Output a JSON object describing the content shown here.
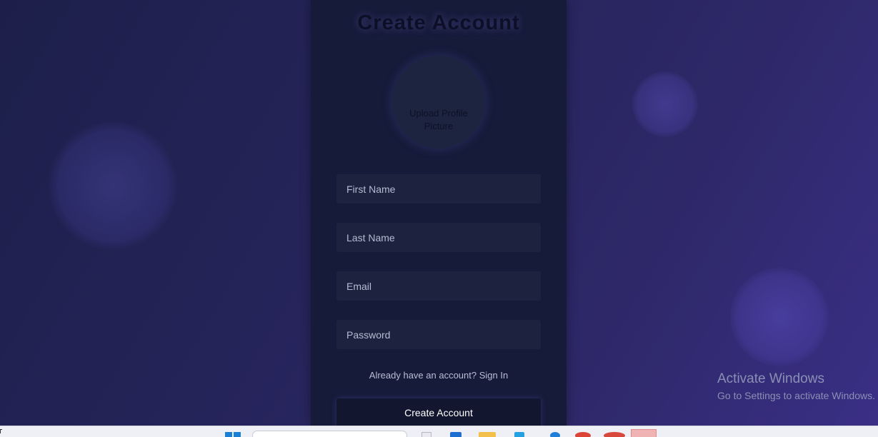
{
  "signup": {
    "title": "Create Account",
    "upload_line1": "Upload Profile",
    "upload_line2": "Picture",
    "first_name_placeholder": "First Name",
    "last_name_placeholder": "Last Name",
    "email_placeholder": "Email",
    "password_placeholder": "Password",
    "signin_prompt": "Already have an account?",
    "signin_link": "Sign In",
    "submit_label": "Create Account"
  },
  "watermark": {
    "title": "Activate Windows",
    "subtitle": "Go to Settings to activate Windows."
  },
  "taskbar": {
    "icons": [
      "windows-start-icon",
      "search-box",
      "file-explorer-icon",
      "outlook-icon",
      "folder-icon",
      "store-icon",
      "edge-icon",
      "chrome-icon",
      "chrome-profile-icon",
      "active-app-icon"
    ]
  },
  "colors": {
    "background_start": "#1d1f4a",
    "background_end": "#3a2f86",
    "panel": "#171b3a",
    "input_bg": "#1d233e",
    "button_bg": "#12162e"
  }
}
